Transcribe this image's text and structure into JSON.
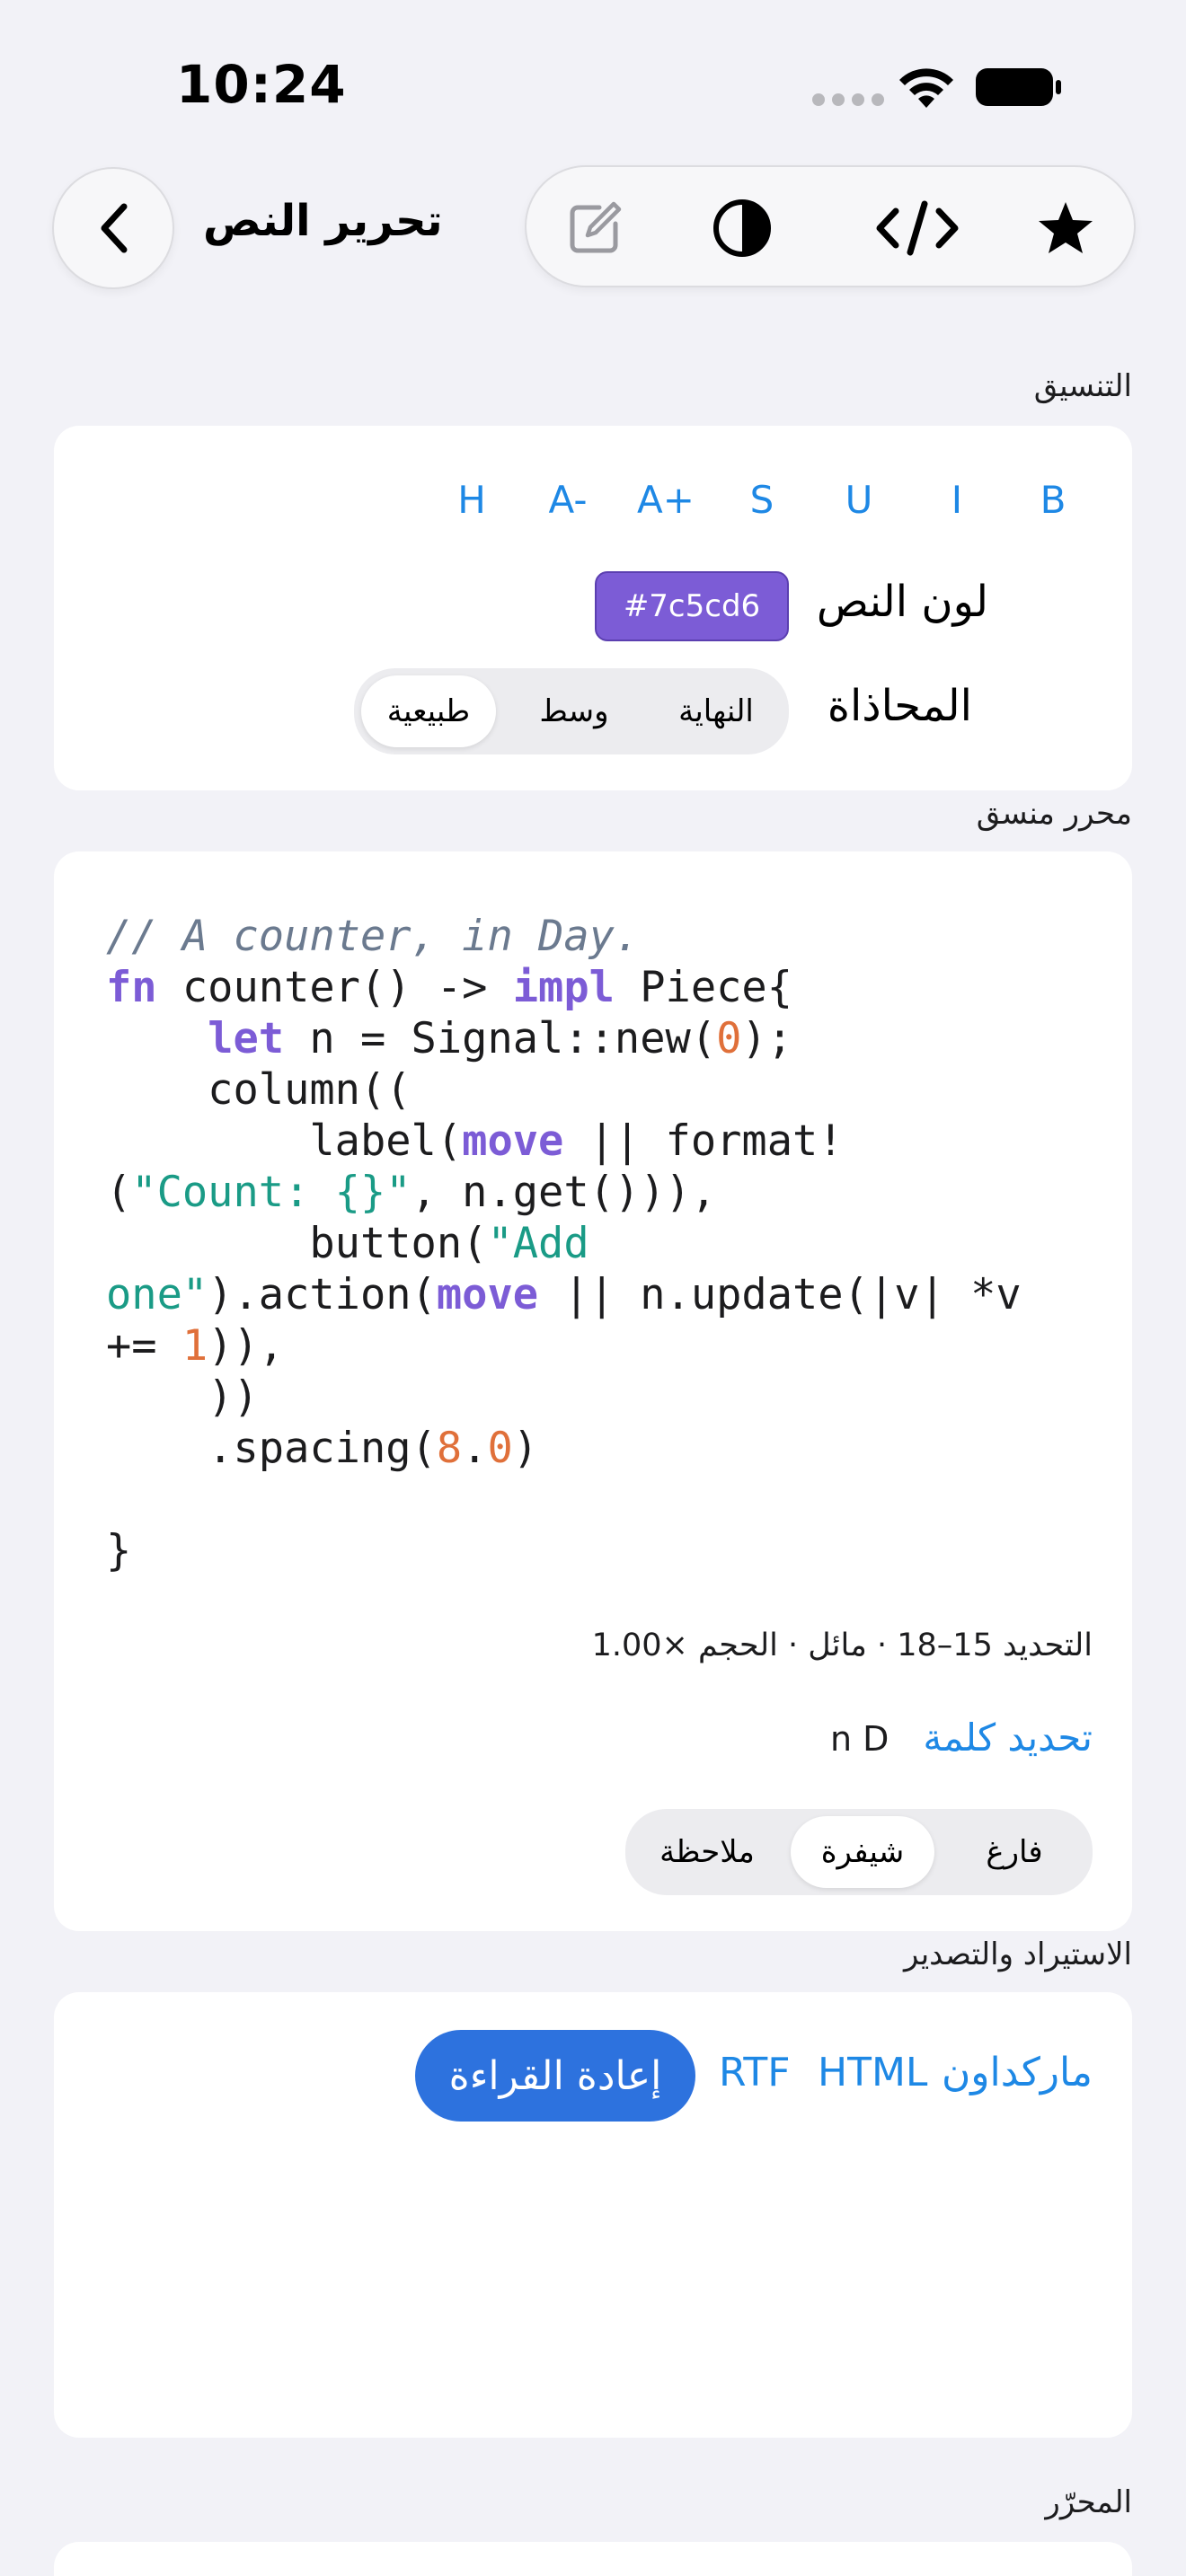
{
  "status_bar": {
    "time": "10:24"
  },
  "nav": {
    "title": "تحرير النص"
  },
  "sections": {
    "formatting": "التنسيق",
    "rich_editor": "محرر منسق",
    "import_export": "الاستيراد والتصدير",
    "editor": "المحرّر"
  },
  "format_buttons": [
    "H",
    "A-",
    "A+",
    "S",
    "U",
    "I",
    "B"
  ],
  "text_color": {
    "label": "لون النص",
    "value": "#7c5cd6"
  },
  "alignment": {
    "label": "المحاذاة",
    "options": [
      "النهاية",
      "وسط",
      "طبيعية"
    ],
    "selected": "طبيعية"
  },
  "editor": {
    "code_lines": [
      "// A counter, in Day.",
      "fn counter() -> impl Piece{",
      "    let n = Signal::new(0);",
      "    column((",
      "        label(move || format!",
      "(\"Count: {}\", n.get())),",
      "        button(\"Add",
      "one\").action(move || n.update(|v| *v",
      "+= 1)),",
      "    ))",
      "    .spacing(8.0)",
      "",
      "}"
    ],
    "info": "التحديد 15–18 · مائل · الحجم ×1.00",
    "select_word": "تحديد كلمة",
    "selected_text": "n D",
    "mode_options": [
      "فارغ",
      "شيفرة",
      "ملاحظة"
    ],
    "mode_selected": "شيفرة"
  },
  "export": {
    "markdown": "ماركداون",
    "html": "HTML",
    "rtf": "RTF",
    "reload": "إعادة القراءة"
  },
  "colors": {
    "accent": "#1e88e5",
    "chip": "#7c5cd6",
    "primary_button": "#2d72de"
  },
  "icons": [
    "chevron-left-icon",
    "compose-icon",
    "contrast-icon",
    "code-icon",
    "star-icon",
    "wifi-icon",
    "battery-icon"
  ]
}
